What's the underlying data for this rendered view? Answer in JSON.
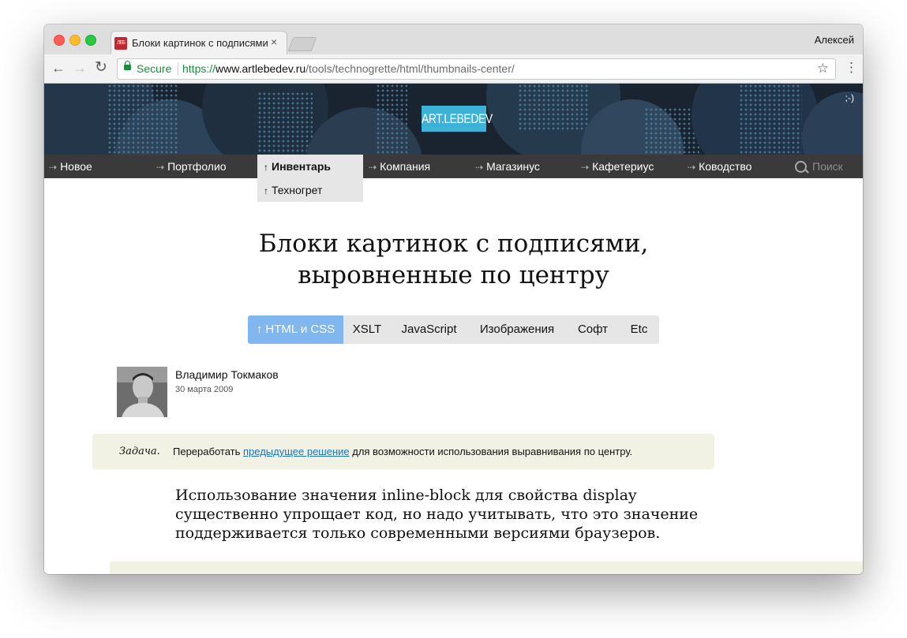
{
  "browser": {
    "tab_title": "Блоки картинок с подписями",
    "tab_close": "×",
    "favicon_text": "ЛЕБ",
    "profile_name": "Алексей",
    "secure_label": "Secure",
    "url_scheme": "https://",
    "url_host": "www.artlebedev.ru",
    "url_path": "/tools/technogrette/html/thumbnails-center/",
    "icons": [
      "back-arrow-icon",
      "forward-arrow-icon",
      "reload-icon",
      "lock-icon",
      "star-icon",
      "menu-icon"
    ]
  },
  "site": {
    "logo": "ART.LEBEDEV",
    "smiley": ";-)",
    "nav": [
      "Новое",
      "Портфолио",
      "Инвентарь",
      "Компания",
      "Магазинус",
      "Кафетериус",
      "Ководство"
    ],
    "nav_active": "Инвентарь",
    "search_label": "Поиск",
    "subnav_item": "Техногрет",
    "colors": {
      "banner": "#1a2330",
      "nav_bg": "#3a3a3a",
      "logo_bg": "#3cb2d8",
      "active_tab": "#7fb7ee",
      "task_bg": "#f2f2e4"
    }
  },
  "article": {
    "title_line1": "Блоки картинок с подписями,",
    "title_line2": "выровненные по центру",
    "tabs": [
      "↑ HTML и CSS",
      "XSLT",
      "JavaScript",
      "Изображения",
      "Софт",
      "Etc"
    ],
    "author": "Владимир Токмаков",
    "date": "30 марта 2009",
    "task_label": "Задача.",
    "task_before": "Переработать ",
    "task_link": "предыдущее решение",
    "task_after": " для возможности использования выравнивания по центру.",
    "body": "Использование значения inline-block для свойства display существенно упрощает код, но надо учитывать, что это значение поддерживается только современными версиями браузеров."
  }
}
